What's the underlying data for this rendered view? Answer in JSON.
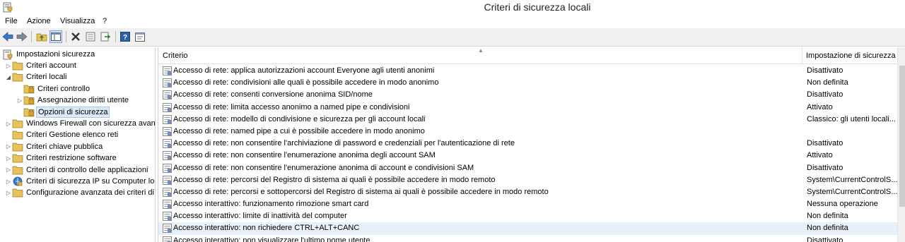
{
  "window": {
    "title": "Criteri di sicurezza locali"
  },
  "menu": [
    "File",
    "Azione",
    "Visualizza",
    "?"
  ],
  "toolbar": {
    "buttons": [
      "back-icon",
      "forward-icon",
      "up-folder-icon",
      "show-hide-tree-icon",
      "delete-icon",
      "properties-icon",
      "export-list-icon",
      "help-icon",
      "console-icon"
    ]
  },
  "tree": {
    "root": "Impostazioni sicurezza",
    "items": [
      {
        "label": "Criteri account",
        "level": 1,
        "expander": "collapsed"
      },
      {
        "label": "Criteri locali",
        "level": 1,
        "expander": "expanded"
      },
      {
        "label": "Criteri controllo",
        "level": 2,
        "expander": "none"
      },
      {
        "label": "Assegnazione diritti utente",
        "level": 2,
        "expander": "collapsed"
      },
      {
        "label": "Opzioni di sicurezza",
        "level": 2,
        "expander": "none",
        "selected": true
      },
      {
        "label": "Windows Firewall con sicurezza avanz",
        "level": 1,
        "expander": "collapsed"
      },
      {
        "label": "Criteri Gestione elenco reti",
        "level": 1,
        "expander": "none"
      },
      {
        "label": "Criteri chiave pubblica",
        "level": 1,
        "expander": "collapsed"
      },
      {
        "label": "Criteri restrizione software",
        "level": 1,
        "expander": "collapsed"
      },
      {
        "label": "Criteri di controllo delle applicazioni",
        "level": 1,
        "expander": "collapsed"
      },
      {
        "label": "Criteri di sicurezza IP su Computer loc",
        "level": 1,
        "expander": "collapsed"
      },
      {
        "label": "Configurazione avanzata dei criteri di",
        "level": 1,
        "expander": "collapsed"
      }
    ]
  },
  "list": {
    "columns": {
      "policy": "Criterio",
      "setting": "Impostazione di sicurezza"
    },
    "rows": [
      {
        "policy": "Accesso di rete: applica autorizzazioni account Everyone agli utenti anonimi",
        "setting": "Disattivato"
      },
      {
        "policy": "Accesso di rete: condivisioni alle quali è possibile accedere in modo anonimo",
        "setting": "Non definita"
      },
      {
        "policy": "Accesso di rete: consenti conversione anonima SID/nome",
        "setting": "Disattivato"
      },
      {
        "policy": "Accesso di rete: limita accesso anonimo a named pipe e condivisioni",
        "setting": "Attivato"
      },
      {
        "policy": "Accesso di rete: modello di condivisione e sicurezza per gli account locali",
        "setting": "Classico: gli utenti locali..."
      },
      {
        "policy": "Accesso di rete: named pipe a cui è possibile accedere in modo anonimo",
        "setting": ""
      },
      {
        "policy": "Accesso di rete: non consentire l'archiviazione di password e credenziali per l'autenticazione di rete",
        "setting": "Disattivato"
      },
      {
        "policy": "Accesso di rete: non consentire l'enumerazione anonima degli account SAM",
        "setting": "Attivato"
      },
      {
        "policy": "Accesso di rete: non consentire l'enumerazione anonima di account e condivisioni SAM",
        "setting": "Disattivato"
      },
      {
        "policy": "Accesso di rete: percorsi del Registro di sistema ai quali è possibile accedere in modo remoto",
        "setting": "System\\CurrentControlS..."
      },
      {
        "policy": "Accesso di rete: percorsi e sottopercorsi del Registro di sistema ai quali è possibile accedere in modo remoto",
        "setting": "System\\CurrentControlS..."
      },
      {
        "policy": "Accesso interattivo: funzionamento rimozione smart card",
        "setting": "Nessuna operazione"
      },
      {
        "policy": "Accesso interattivo: limite di inattività del computer",
        "setting": "Non definita"
      },
      {
        "policy": "Accesso interattivo: non richiedere CTRL+ALT+CANC",
        "setting": "Non definita",
        "highlight": true
      },
      {
        "policy": "Accesso interattivo: non visualizzare l'ultimo nome utente",
        "setting": "Disattivato"
      }
    ]
  },
  "colors": {
    "selection": "#dbe9f8",
    "folder": "#e8c25a",
    "toolbar_bg": "#f0f0f0"
  }
}
